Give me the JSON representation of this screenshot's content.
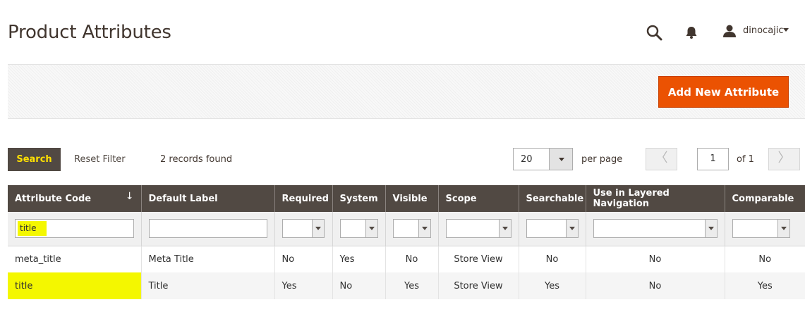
{
  "header": {
    "title": "Product Attributes",
    "user_name": "dinocajic"
  },
  "actions": {
    "add_label": "Add New Attribute"
  },
  "toolbar": {
    "search_label": "Search",
    "reset_label": "Reset Filter",
    "records_found": "2 records found",
    "per_page_value": "20",
    "per_page_label": "per page",
    "page_number": "1",
    "page_of": "of 1",
    "prev_glyph": "〈",
    "next_glyph": "〉"
  },
  "grid": {
    "sort_arrow": "↓",
    "columns": [
      "Attribute Code",
      "Default Label",
      "Required",
      "System",
      "Visible",
      "Scope",
      "Searchable",
      "Use in Layered Navigation",
      "Comparable"
    ],
    "filters": {
      "attribute_code": "title"
    },
    "rows": [
      [
        "meta_title",
        "Meta Title",
        "No",
        "Yes",
        "No",
        "Store View",
        "No",
        "No",
        "No"
      ],
      [
        "title",
        "Title",
        "Yes",
        "No",
        "Yes",
        "Store View",
        "Yes",
        "No",
        "Yes"
      ]
    ]
  },
  "colors": {
    "accent": "#eb5202",
    "header_bg": "#514943",
    "highlight": "#f4f700",
    "search_text": "#ffe000"
  }
}
